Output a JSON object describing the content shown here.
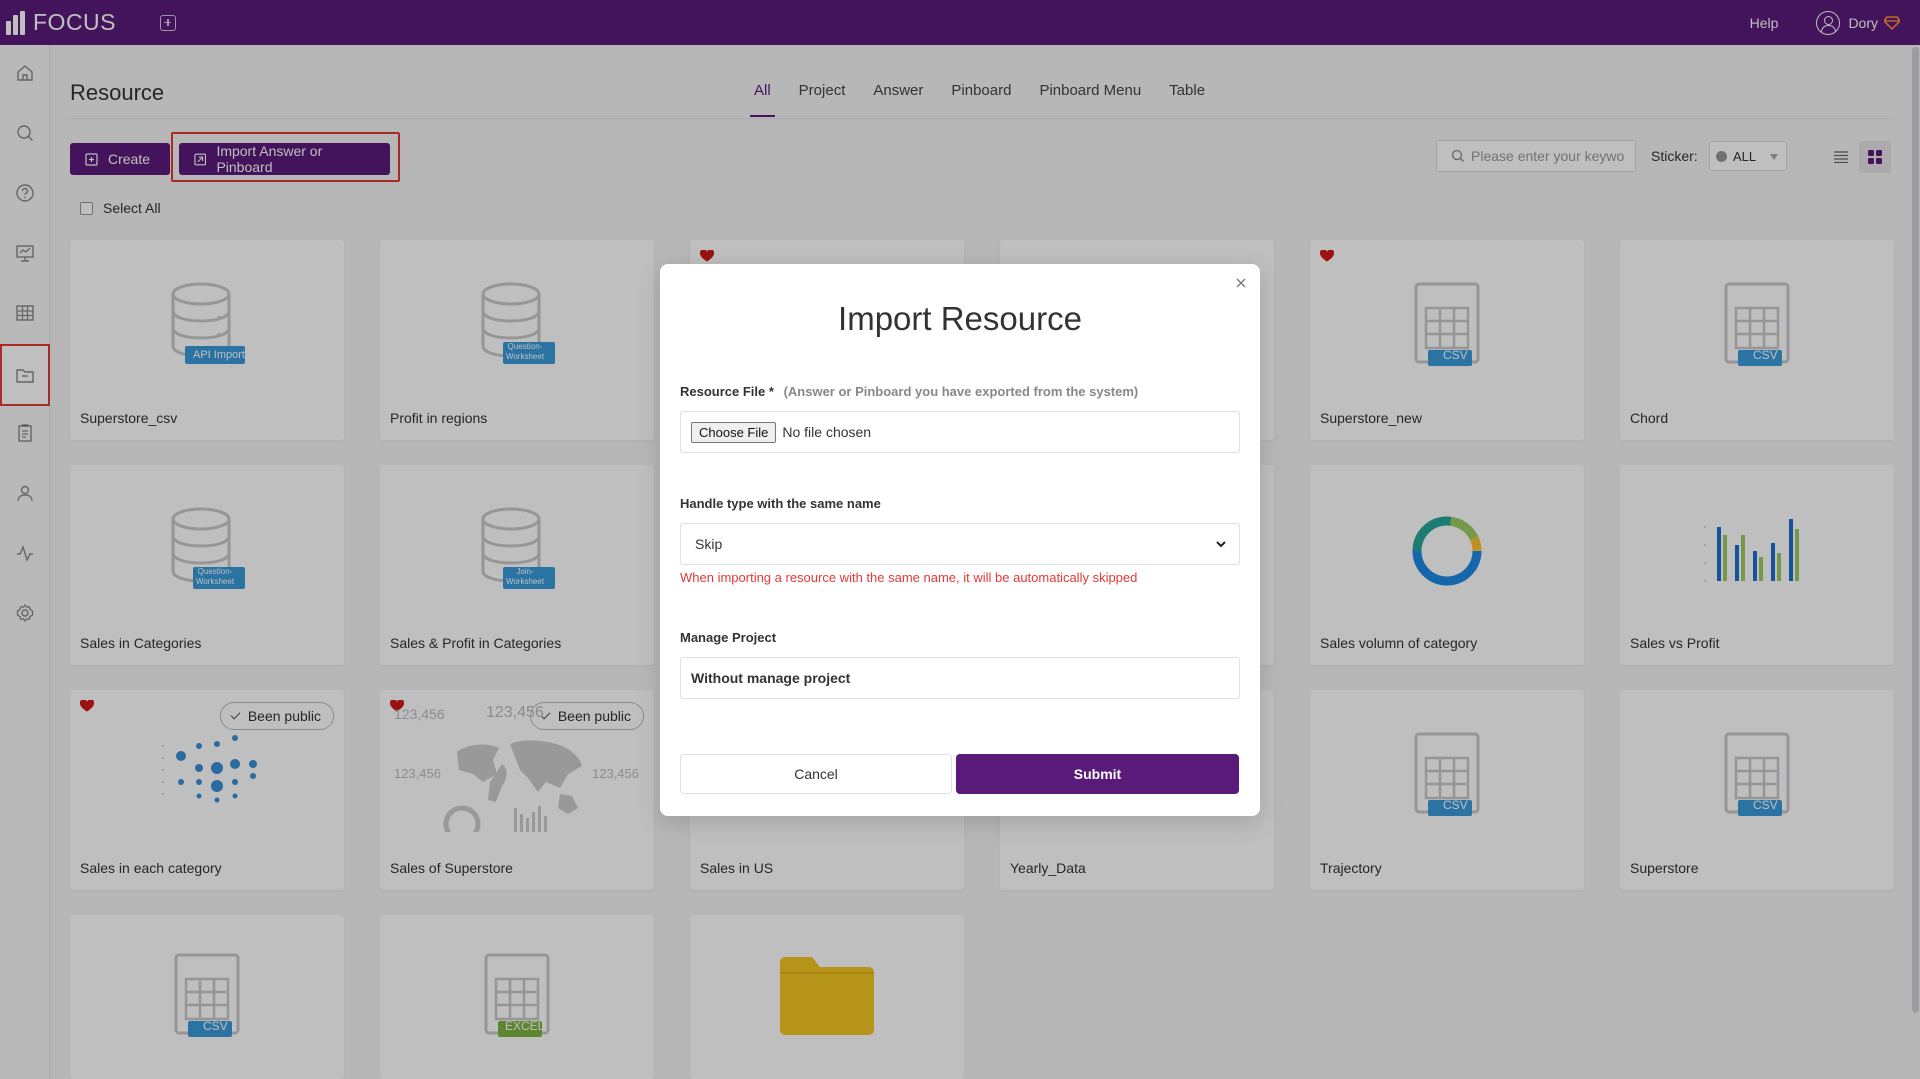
{
  "app": {
    "logo_text": "FOCUS",
    "help": "Help",
    "user": "Dory"
  },
  "colors": {
    "brand": "#5a1a7a",
    "highlight": "#e53935",
    "warning": "#e53935",
    "csv_badge": "#3a9ad9",
    "excel_badge": "#7cb342",
    "folder": "#f3c623"
  },
  "page": {
    "title": "Resource"
  },
  "tabs": [
    {
      "label": "All",
      "active": true
    },
    {
      "label": "Project"
    },
    {
      "label": "Answer"
    },
    {
      "label": "Pinboard"
    },
    {
      "label": "Pinboard Menu"
    },
    {
      "label": "Table"
    }
  ],
  "toolbar": {
    "create": "Create",
    "import": "Import Answer or Pinboard",
    "select_all": "Select All",
    "search_placeholder": "Please enter your keywo",
    "sticker_label": "Sticker:",
    "sticker_value": "ALL"
  },
  "sidebar": [
    "home-icon",
    "search-icon",
    "help-icon",
    "pinboard-icon",
    "table-icon",
    "folder-icon",
    "clipboard-icon",
    "user-icon",
    "activity-icon",
    "settings-icon"
  ],
  "cards": [
    {
      "title": "Superstore_csv",
      "badge": "API Import"
    },
    {
      "title": "Profit in regions",
      "badge": "Question-Worksheet"
    },
    {
      "title": "Superstore_new",
      "badge": "CSV"
    },
    {
      "title": "Chord",
      "badge": "CSV"
    },
    {
      "title": "Sales in Categories",
      "badge": "Question-Worksheet"
    },
    {
      "title": "Sales & Profit in Categories",
      "badge": "Join-Worksheet"
    },
    {
      "title": "Sales volumn of category"
    },
    {
      "title": "Sales vs Profit"
    },
    {
      "title": "Sales in each category",
      "public": "Been public"
    },
    {
      "title": "Sales of Superstore",
      "public": "Been public",
      "kpi": "123,456"
    },
    {
      "title": "Sales in US"
    },
    {
      "title": "Yearly_Data"
    },
    {
      "title": "Trajectory",
      "badge": "CSV"
    },
    {
      "title": "Superstore",
      "badge": "CSV"
    },
    {
      "badge": "CSV"
    },
    {
      "badge": "EXCEL"
    }
  ],
  "modal": {
    "title": "Import Resource",
    "file_label": "Resource File *",
    "file_hint": "(Answer or Pinboard you have exported from the system)",
    "file_button": "Choose File",
    "file_status": "No file chosen",
    "handle_label": "Handle type with the same name",
    "handle_value": "Skip",
    "handle_warning": "When importing a resource with the same name, it will be automatically skipped",
    "project_label": "Manage Project",
    "project_value": "Without manage project",
    "cancel": "Cancel",
    "submit": "Submit"
  }
}
